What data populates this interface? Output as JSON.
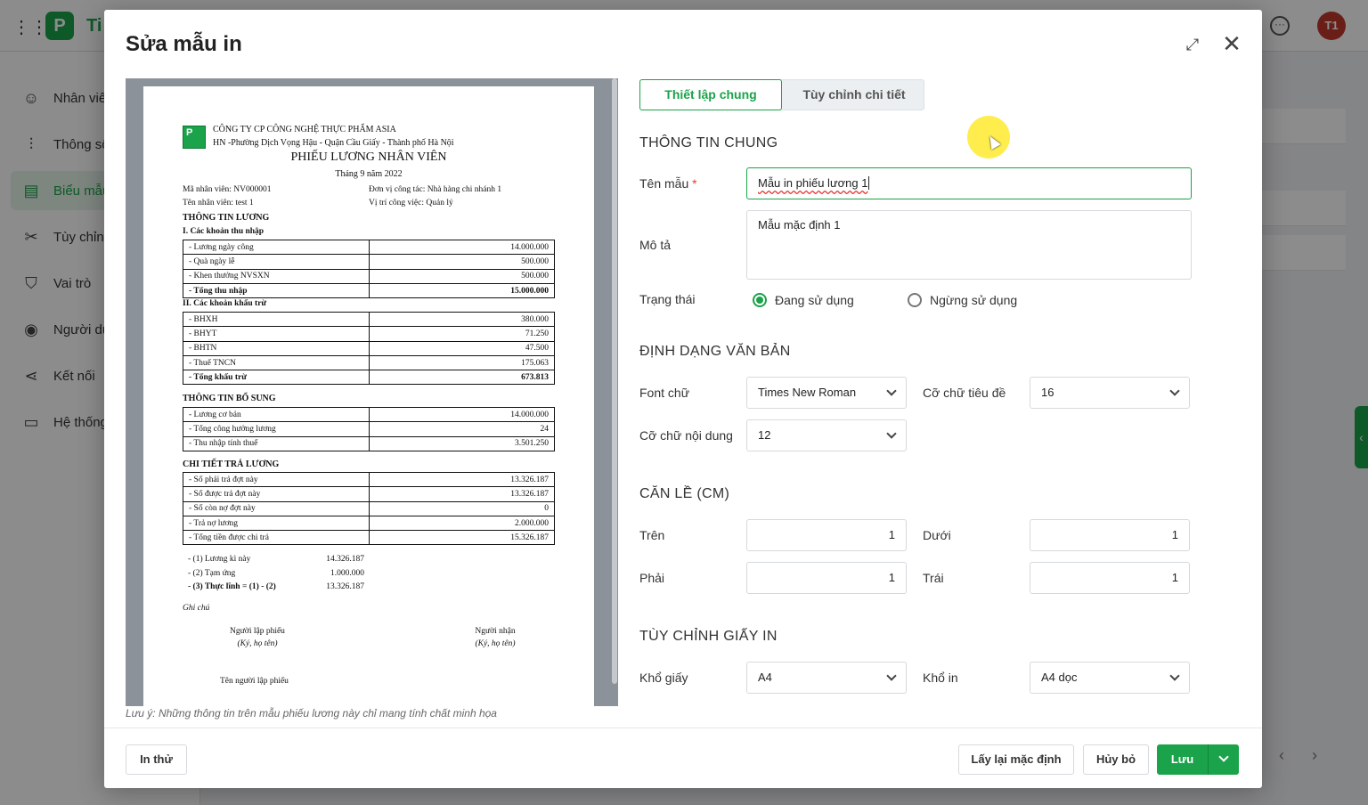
{
  "background": {
    "logo_letter": "P",
    "logo_text": "Ti",
    "avatar": "T1",
    "sidebar": [
      {
        "label": "Nhân viên",
        "icon": "people-icon"
      },
      {
        "label": "Thông số",
        "icon": "sliders-icon"
      },
      {
        "label": "Biểu mẫu",
        "icon": "document-icon"
      },
      {
        "label": "Tùy chỉnh",
        "icon": "tools-icon"
      },
      {
        "label": "Vai trò",
        "icon": "shield-icon"
      },
      {
        "label": "Người dù",
        "icon": "user-circle-icon"
      },
      {
        "label": "Kết nối",
        "icon": "share-icon"
      },
      {
        "label": "Hệ thống",
        "icon": "monitor-icon"
      }
    ]
  },
  "modal": {
    "title": "Sửa mẫu in",
    "tabs": [
      "Thiết lập chung",
      "Tùy chỉnh chi tiết"
    ],
    "preview_note": "Lưu ý: Những thông tin trên mẫu phiếu lương này chỉ mang tính chất minh họa",
    "general": {
      "heading": "THÔNG TIN CHUNG",
      "name_label": "Tên mẫu",
      "required_mark": "*",
      "name_value": "Mẫu in phiếu lương 1",
      "desc_label": "Mô tả",
      "desc_value": "Mẫu mặc định 1",
      "status_label": "Trạng thái",
      "status_options": [
        "Đang sử dụng",
        "Ngừng sử dụng"
      ]
    },
    "format": {
      "heading": "ĐỊNH DẠNG VĂN BẢN",
      "font_label": "Font chữ",
      "font_value": "Times New Roman",
      "title_size_label": "Cỡ chữ tiêu đề",
      "title_size_value": "16",
      "body_size_label": "Cỡ chữ nội dung",
      "body_size_value": "12"
    },
    "margins": {
      "heading": "CĂN LỀ (CM)",
      "top_label": "Trên",
      "top_value": "1",
      "bottom_label": "Dưới",
      "bottom_value": "1",
      "right_label": "Phải",
      "right_value": "1",
      "left_label": "Trái",
      "left_value": "1"
    },
    "paper": {
      "heading": "TÙY CHỈNH GIẤY IN",
      "size_label": "Khổ giấy",
      "size_value": "A4",
      "orient_label": "Khổ in",
      "orient_value": "A4 dọc"
    },
    "footer": {
      "print_test": "In thử",
      "reset": "Lấy lại mặc định",
      "cancel": "Hủy bỏ",
      "save": "Lưu"
    }
  },
  "payslip": {
    "company": "CÔNG TY CP CÔNG NGHỆ THỰC PHẨM ASIA",
    "address": "HN -Phường Dịch Vọng Hậu - Quận Cầu Giấy - Thành phố Hà Nội",
    "title": "PHIẾU LƯƠNG NHÂN VIÊN",
    "month": "Tháng 9 năm 2022",
    "emp_code": "Mã nhân viên:  NV000001",
    "emp_name": "Tên nhân viên:  test 1",
    "unit": "Đơn vị công tác:  Nhà hàng chi nhánh 1",
    "position": "Vị trí công việc:  Quản lý",
    "sec_salary": "THÔNG TIN LƯƠNG",
    "sec_income": "I. Các khoản thu nhập",
    "income": [
      [
        "- Lương ngày công",
        "14.000.000"
      ],
      [
        "- Quà ngày lễ",
        "500.000"
      ],
      [
        "- Khen thưởng NVSXN",
        "500.000"
      ],
      [
        "- Tổng thu nhập",
        "15.000.000"
      ]
    ],
    "sec_deduct": "II. Các khoản khấu trừ",
    "deduct": [
      [
        "- BHXH",
        "380.000"
      ],
      [
        "- BHYT",
        "71.250"
      ],
      [
        "- BHTN",
        "47.500"
      ],
      [
        "- Thuế TNCN",
        "175.063"
      ],
      [
        "- Tổng khấu trừ",
        "673.813"
      ]
    ],
    "sec_extra": "THÔNG TIN BỔ SUNG",
    "extra": [
      [
        "- Lương cơ bản",
        "14.000.000"
      ],
      [
        "- Tổng công hưởng lương",
        "24"
      ],
      [
        "- Thu nhập tính thuế",
        "3.501.250"
      ]
    ],
    "sec_pay": "CHI TIẾT TRẢ LƯƠNG",
    "pay": [
      [
        "- Số phải trả đợt này",
        "13.326.187"
      ],
      [
        "- Số được trả đợt này",
        "13.326.187"
      ],
      [
        "- Số còn nợ đợt này",
        "0"
      ],
      [
        "- Trả nợ lương",
        "2.000.000"
      ],
      [
        "- Tổng tiền được chi trả",
        "15.326.187"
      ]
    ],
    "sum1_label": "- (1) Lương kì này",
    "sum1_value": "14.326.187",
    "sum2_label": "- (2) Tạm ứng",
    "sum2_value": "1.000.000",
    "sum3_label": "- (3) Thực lĩnh = (1) - (2)",
    "sum3_value": "13.326.187",
    "note": "Ghi chú",
    "signer": "Người lập phiếu",
    "receiver": "Người nhận",
    "sign_hint": "(Ký, họ tên)",
    "signer_name": "Tên người lập phiếu"
  }
}
